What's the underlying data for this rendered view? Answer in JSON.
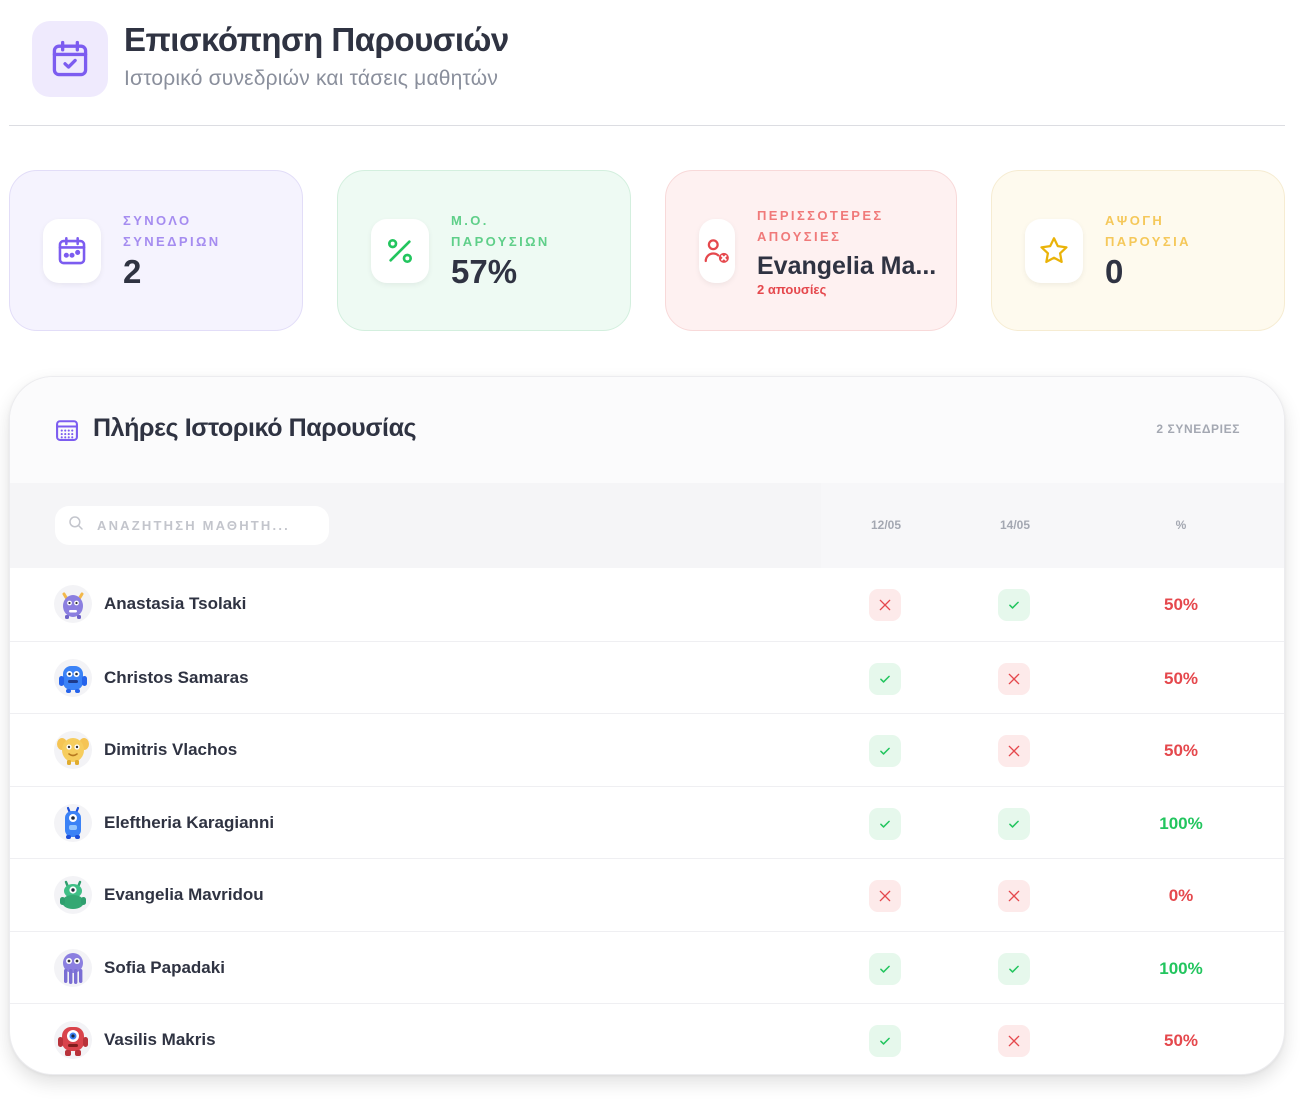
{
  "header": {
    "icon": "calendar-check-icon",
    "title": "Επισκόπηση Παρουσιών",
    "subtitle": "Ιστορικό συνεδριών και τάσεις μαθητών"
  },
  "stats": {
    "sessions": {
      "label": "ΣΥΝΟΛΟ ΣΥΝΕΔΡΙΩΝ",
      "value": "2",
      "icon": "calendar-icon",
      "color": "#7c5cf0"
    },
    "average": {
      "label": "Μ.Ο. ΠΑΡΟΥΣΙΩΝ",
      "value": "57%",
      "icon": "percent-icon",
      "color": "#22c55e"
    },
    "most_absent": {
      "label": "ΠΕΡΙΣΣΟΤΕΡΕΣ ΑΠΟΥΣΙΕΣ",
      "value": "Evangelia Ma...",
      "sub": "2 απουσίες",
      "icon": "user-x-icon",
      "color": "#e5484d"
    },
    "perfect": {
      "label": "ΑΨΟΓΗ ΠΑΡΟΥΣΙΑ",
      "value": "0",
      "icon": "star-icon",
      "color": "#eab308"
    }
  },
  "panel": {
    "title": "Πλήρες Ιστορικό Παρουσίας",
    "count": "2 ΣΥΝΕΔΡΙΕΣ",
    "search_placeholder": "ΑΝΑΖΗΤΗΣΗ ΜΑΘΗΤΗ...",
    "columns": [
      "12/05",
      "14/05",
      "%"
    ]
  },
  "students": [
    {
      "name": "Anastasia Tsolaki",
      "avatar": "purple-horned-monster-avatar",
      "marks": [
        "absent",
        "present"
      ],
      "percent": "50%"
    },
    {
      "name": "Christos Samaras",
      "avatar": "blue-monster-avatar",
      "marks": [
        "present",
        "absent"
      ],
      "percent": "50%"
    },
    {
      "name": "Dimitris Vlachos",
      "avatar": "yellow-monster-avatar",
      "marks": [
        "present",
        "absent"
      ],
      "percent": "50%"
    },
    {
      "name": "Eleftheria Karagianni",
      "avatar": "blue-one-eyed-monster-avatar",
      "marks": [
        "present",
        "present"
      ],
      "percent": "100%"
    },
    {
      "name": "Evangelia Mavridou",
      "avatar": "green-monster-avatar",
      "marks": [
        "absent",
        "absent"
      ],
      "percent": "0%"
    },
    {
      "name": "Sofia Papadaki",
      "avatar": "purple-tentacle-monster-avatar",
      "marks": [
        "present",
        "present"
      ],
      "percent": "100%"
    },
    {
      "name": "Vasilis Makris",
      "avatar": "red-cyclops-monster-avatar",
      "marks": [
        "present",
        "absent"
      ],
      "percent": "50%"
    }
  ]
}
